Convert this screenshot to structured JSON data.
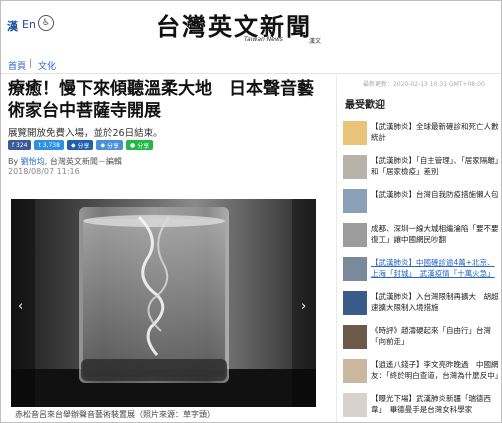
{
  "header": {
    "lang_zh": "漢",
    "lang_en": "En",
    "access_icon": "accessibility-icon",
    "logo_title": "台灣英文新聞",
    "logo_sub": "Taiwan News",
    "logo_seal": "漢文"
  },
  "breadcrumb": {
    "home": "首頁",
    "sep": "|",
    "category": "文化"
  },
  "article": {
    "title": "療癒！慢下來傾聽溫柔大地　日本聲音藝術家台中菩薩寺開展",
    "subtitle": "展覽開放免費入場，並於26日結束。",
    "share": {
      "facebook_count": "324",
      "facebook_icon": "facebook-icon",
      "twitter_count": "3,738",
      "twitter_icon": "twitter-icon",
      "buttons": [
        "分享",
        "分享",
        "分享"
      ],
      "button_icons": [
        "share-icon",
        "share-icon",
        "line-icon"
      ]
    },
    "byline_prefix": "By",
    "author": "劉怡均",
    "byline_suffix": "台灣英文新聞－編輯",
    "date": "2018/08/07 11:16",
    "photo_caption": "赤松音呂來台舉辦聲音藝術裝置展（照片來源：草字頭）",
    "photo_prev": "‹",
    "photo_next": "›"
  },
  "sidebar": {
    "updated": "最新更新：2020-02-13 10:31 GMT+08:00",
    "popular_title": "最受歡迎",
    "items": [
      {
        "text": "【武漢肺炎】全球最新確診和死亡人數統計"
      },
      {
        "text": "【武漢肺炎】「自主管理」、「居家隔離」和「居家檢疫」差別"
      },
      {
        "text": "【武漢肺炎】台灣自我防疫措施懶人包"
      },
      {
        "text": "成都、深圳一線大城相繼淪陷「要不要復工」讓中國網民吵翻"
      },
      {
        "text": "【武漢肺炎】中國確診逾4萬+北京、上海「封城」　武漢疫情「十萬火急」",
        "highlight": true
      },
      {
        "text": "【武漢肺炎】入台灣限制再擴大　胡超速擴大限制入境措施"
      },
      {
        "text": "《時評》趙濤硬起來「自由行」台灣「向前走」"
      },
      {
        "text": "【逍遙八錢子】李文亮昨晚過　中國網友：「終於明白查道，台灣為什麼反中」"
      },
      {
        "text": "【曝光下場】武漢肺炎新疆「瑞德西韋」　畢德曼手是台灣女科學家"
      }
    ]
  }
}
